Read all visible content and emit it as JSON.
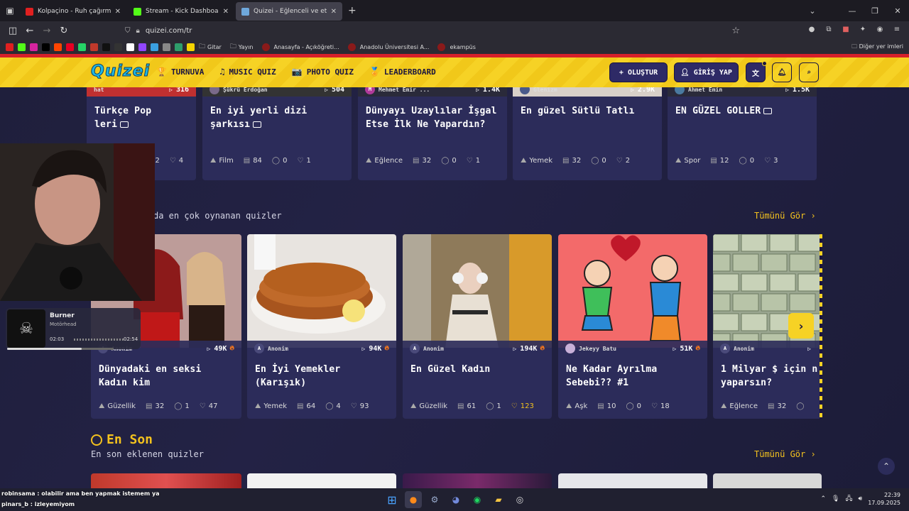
{
  "browser": {
    "tabs": [
      {
        "label": "Kolpaçino - Ruh çağırma sahnesi",
        "favicon_color": "#e02020",
        "active": false
      },
      {
        "label": "Stream - Kick Dashboard",
        "favicon_color": "#53fc18",
        "active": false
      },
      {
        "label": "Quizei - Eğlenceli ve etkileşimli",
        "favicon_color": "#6fa8dc",
        "active": true
      }
    ],
    "url": "quizei.com/tr",
    "bookmarks": [
      {
        "label": "Gitar",
        "folder": true
      },
      {
        "label": "Yayın",
        "folder": true
      },
      {
        "label": "Anasayfa - Açıköğreti...",
        "folder": false
      },
      {
        "label": "Anadolu Üniversitesi A...",
        "folder": false
      },
      {
        "label": "ekampüs",
        "folder": false
      }
    ],
    "bookmarks_other": "Diğer yer imleri"
  },
  "site": {
    "logo": "Quizei",
    "nav": [
      {
        "label": "TURNUVA",
        "icon": "trophy-icon",
        "glyph": "🏆"
      },
      {
        "label": "MUSIC QUIZ",
        "icon": "music-note-icon",
        "glyph": "♫"
      },
      {
        "label": "PHOTO QUIZ",
        "icon": "camera-icon",
        "glyph": "📷"
      },
      {
        "label": "LEADERBOARD",
        "icon": "award-icon",
        "glyph": "🏅"
      }
    ],
    "create_label": "+ OLUŞTUR",
    "login_label": "GİRİŞ YAP",
    "colors": {
      "accent": "#f6d225",
      "header_bar": "#d6202a",
      "card_bg": "#2c2c5a",
      "gold": "#f4c21e"
    }
  },
  "top_row": [
    {
      "author": "hat",
      "plays": "316",
      "title": "Türkçe Pop\nleri",
      "has_video": true,
      "category": "",
      "questions": "2",
      "comments": "",
      "likes": "4",
      "avatar_color": "#555"
    },
    {
      "author": "Şükrü Erdoğan",
      "plays": "504",
      "title": "En iyi yerli dizi\nşarkısı",
      "has_video": true,
      "category": "Film",
      "questions": "84",
      "comments": "0",
      "likes": "1",
      "avatar_color": "#7a6a8a"
    },
    {
      "author": "Mehmet Emir ...",
      "plays": "1.4K",
      "title": "Dünyayı Uzaylılar İşgal\nEtse İlk Ne Yapardın?",
      "has_video": false,
      "category": "Eğlence",
      "questions": "32",
      "comments": "0",
      "likes": "1",
      "avatar_color": "#b03a9a",
      "avatar_letter": "M"
    },
    {
      "author": "Glenizm",
      "plays": "2.9K",
      "title": "En güzel Sütlü Tatlı",
      "has_video": false,
      "category": "Yemek",
      "questions": "32",
      "comments": "0",
      "likes": "2",
      "avatar_color": "#4a5a8a"
    },
    {
      "author": "Ahmet Emin",
      "plays": "1.5K",
      "title": "EN GÜZEL GOLLER",
      "has_video": true,
      "category": "Spor",
      "questions": "12",
      "comments": "0",
      "likes": "3",
      "avatar_color": "#4a7aa0"
    }
  ],
  "popular": {
    "subtitle": "da en çok oynanan quizler",
    "see_all": "Tümünü Gör ›",
    "cards": [
      {
        "author": "Anonim",
        "plays": "49K",
        "title": "Dünyadaki en seksi\nKadın kim",
        "category": "Güzellik",
        "questions": "32",
        "comments": "1",
        "likes": "47",
        "likes_gold": false,
        "image": "red-carpet-photo"
      },
      {
        "author": "Anonim",
        "plays": "94K",
        "title": "En İyi Yemekler\n(Karışık)",
        "category": "Yemek",
        "questions": "64",
        "comments": "4",
        "likes": "93",
        "likes_gold": false,
        "image": "lahmacun-photo"
      },
      {
        "author": "Anonim",
        "plays": "194K",
        "title": "En Güzel Kadın",
        "category": "Güzellik",
        "questions": "61",
        "comments": "1",
        "likes": "123",
        "likes_gold": true,
        "image": "girl-headphones-photo"
      },
      {
        "author": "Jekeyy Batu",
        "plays": "51K",
        "title": "Ne Kadar Ayrılma\nSebebi?? #1",
        "category": "Aşk",
        "questions": "10",
        "comments": "0",
        "likes": "18",
        "likes_gold": false,
        "image": "breakup-illustration"
      },
      {
        "author": "Anonim",
        "plays": "",
        "title": "1 Milyar $ için n\nyaparsın?",
        "category": "Eğlence",
        "questions": "32",
        "comments": "",
        "likes": "",
        "likes_gold": false,
        "image": "money-stacks-photo"
      }
    ]
  },
  "latest": {
    "title": "En Son",
    "subtitle": "En son eklenen quizler",
    "see_all": "Tümünü Gör ›"
  },
  "overlay": {
    "music": {
      "title": "Burner",
      "artist": "Motörhead",
      "elapsed": "02:03",
      "total": "02:54",
      "progress": 0.7
    },
    "chat": [
      {
        "user": "robinsama",
        "text": "olabilir ama ben yapmak istemem ya"
      },
      {
        "user": "pinars_b",
        "text": "izleyemiyom"
      }
    ]
  },
  "taskbar": {
    "time": "22:39",
    "date": "17.09.2025"
  }
}
